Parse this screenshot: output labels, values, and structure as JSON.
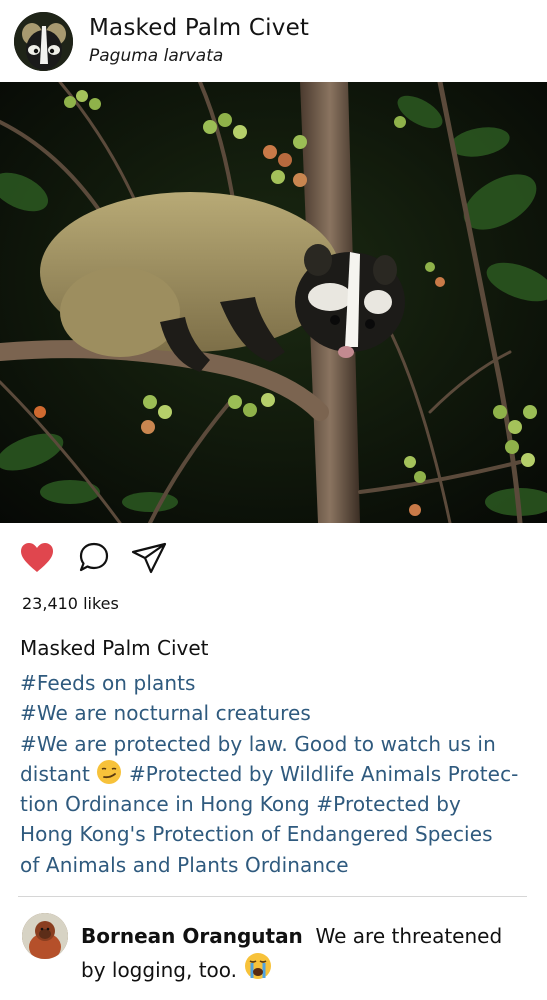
{
  "post": {
    "title": "Masked Palm Civet",
    "subtitle": "Paguma larvata"
  },
  "actions": {
    "like_icon": "heart-icon",
    "comment_icon": "comment-bubble-icon",
    "share_icon": "paper-plane-icon",
    "liked": true,
    "like_color": "#e0464e"
  },
  "likes": "23,410 likes",
  "caption": {
    "title": "Masked Palm Civet",
    "lines": [
      "#Feeds on plants",
      "#We are nocturnal creatures",
      "#We are protected by law. Good to watch us in",
      "distant",
      "#Protected by Wildlife Animals Protec-",
      "tion Ordinance in Hong Kong  #Protected by",
      "Hong Kong's Protection of Endangered Species",
      "of Animals and Plants Ordinance"
    ],
    "emoji_1": "smirking-face-emoji",
    "tag_color": "#2f5a7e"
  },
  "comment": {
    "user": "Bornean Orangutan",
    "text_1": "We are threatened",
    "text_2": "by logging, too.",
    "emoji": "crying-face-emoji"
  }
}
